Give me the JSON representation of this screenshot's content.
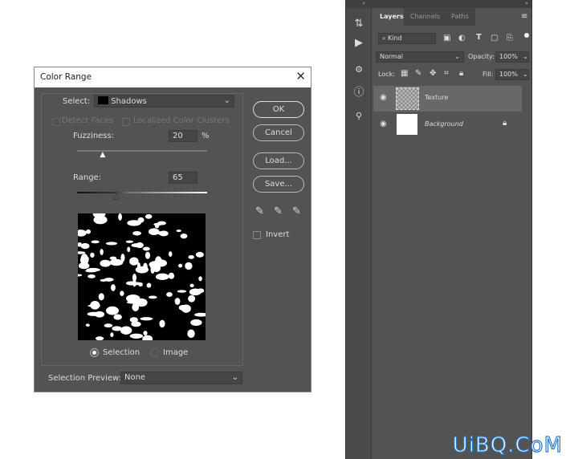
{
  "dialog": {
    "title": "Color Range",
    "close": "✕",
    "select_label": "Select:",
    "select_value": "Shadows",
    "select_swatch": "#000000",
    "detect_faces": "Detect Faces",
    "localized": "Localized Color Clusters",
    "fuzziness_label": "Fuzziness:",
    "fuzziness": "20",
    "percent": "%",
    "fuzziness_fraction": 0.2,
    "range_label": "Range:",
    "range": "65",
    "range_fraction": 0.65,
    "ok": "OK",
    "cancel": "Cancel",
    "load": "Load...",
    "save": "Save...",
    "invert": "Invert",
    "selection": "Selection",
    "image": "Image",
    "preview_label": "Selection Preview:",
    "preview_value": "None"
  },
  "panel": {
    "tabs": [
      "Layers",
      "Channels",
      "Paths"
    ],
    "kind": "Kind",
    "blend": "Normal",
    "opacity_label": "Opacity:",
    "opacity": "100%",
    "lock_label": "Lock:",
    "fill_label": "Fill:",
    "fill": "100%",
    "layers": [
      {
        "name": "Texture",
        "selected": true
      },
      {
        "name": "Background",
        "locked": true
      }
    ]
  },
  "watermark": "UiBQ.CoM"
}
